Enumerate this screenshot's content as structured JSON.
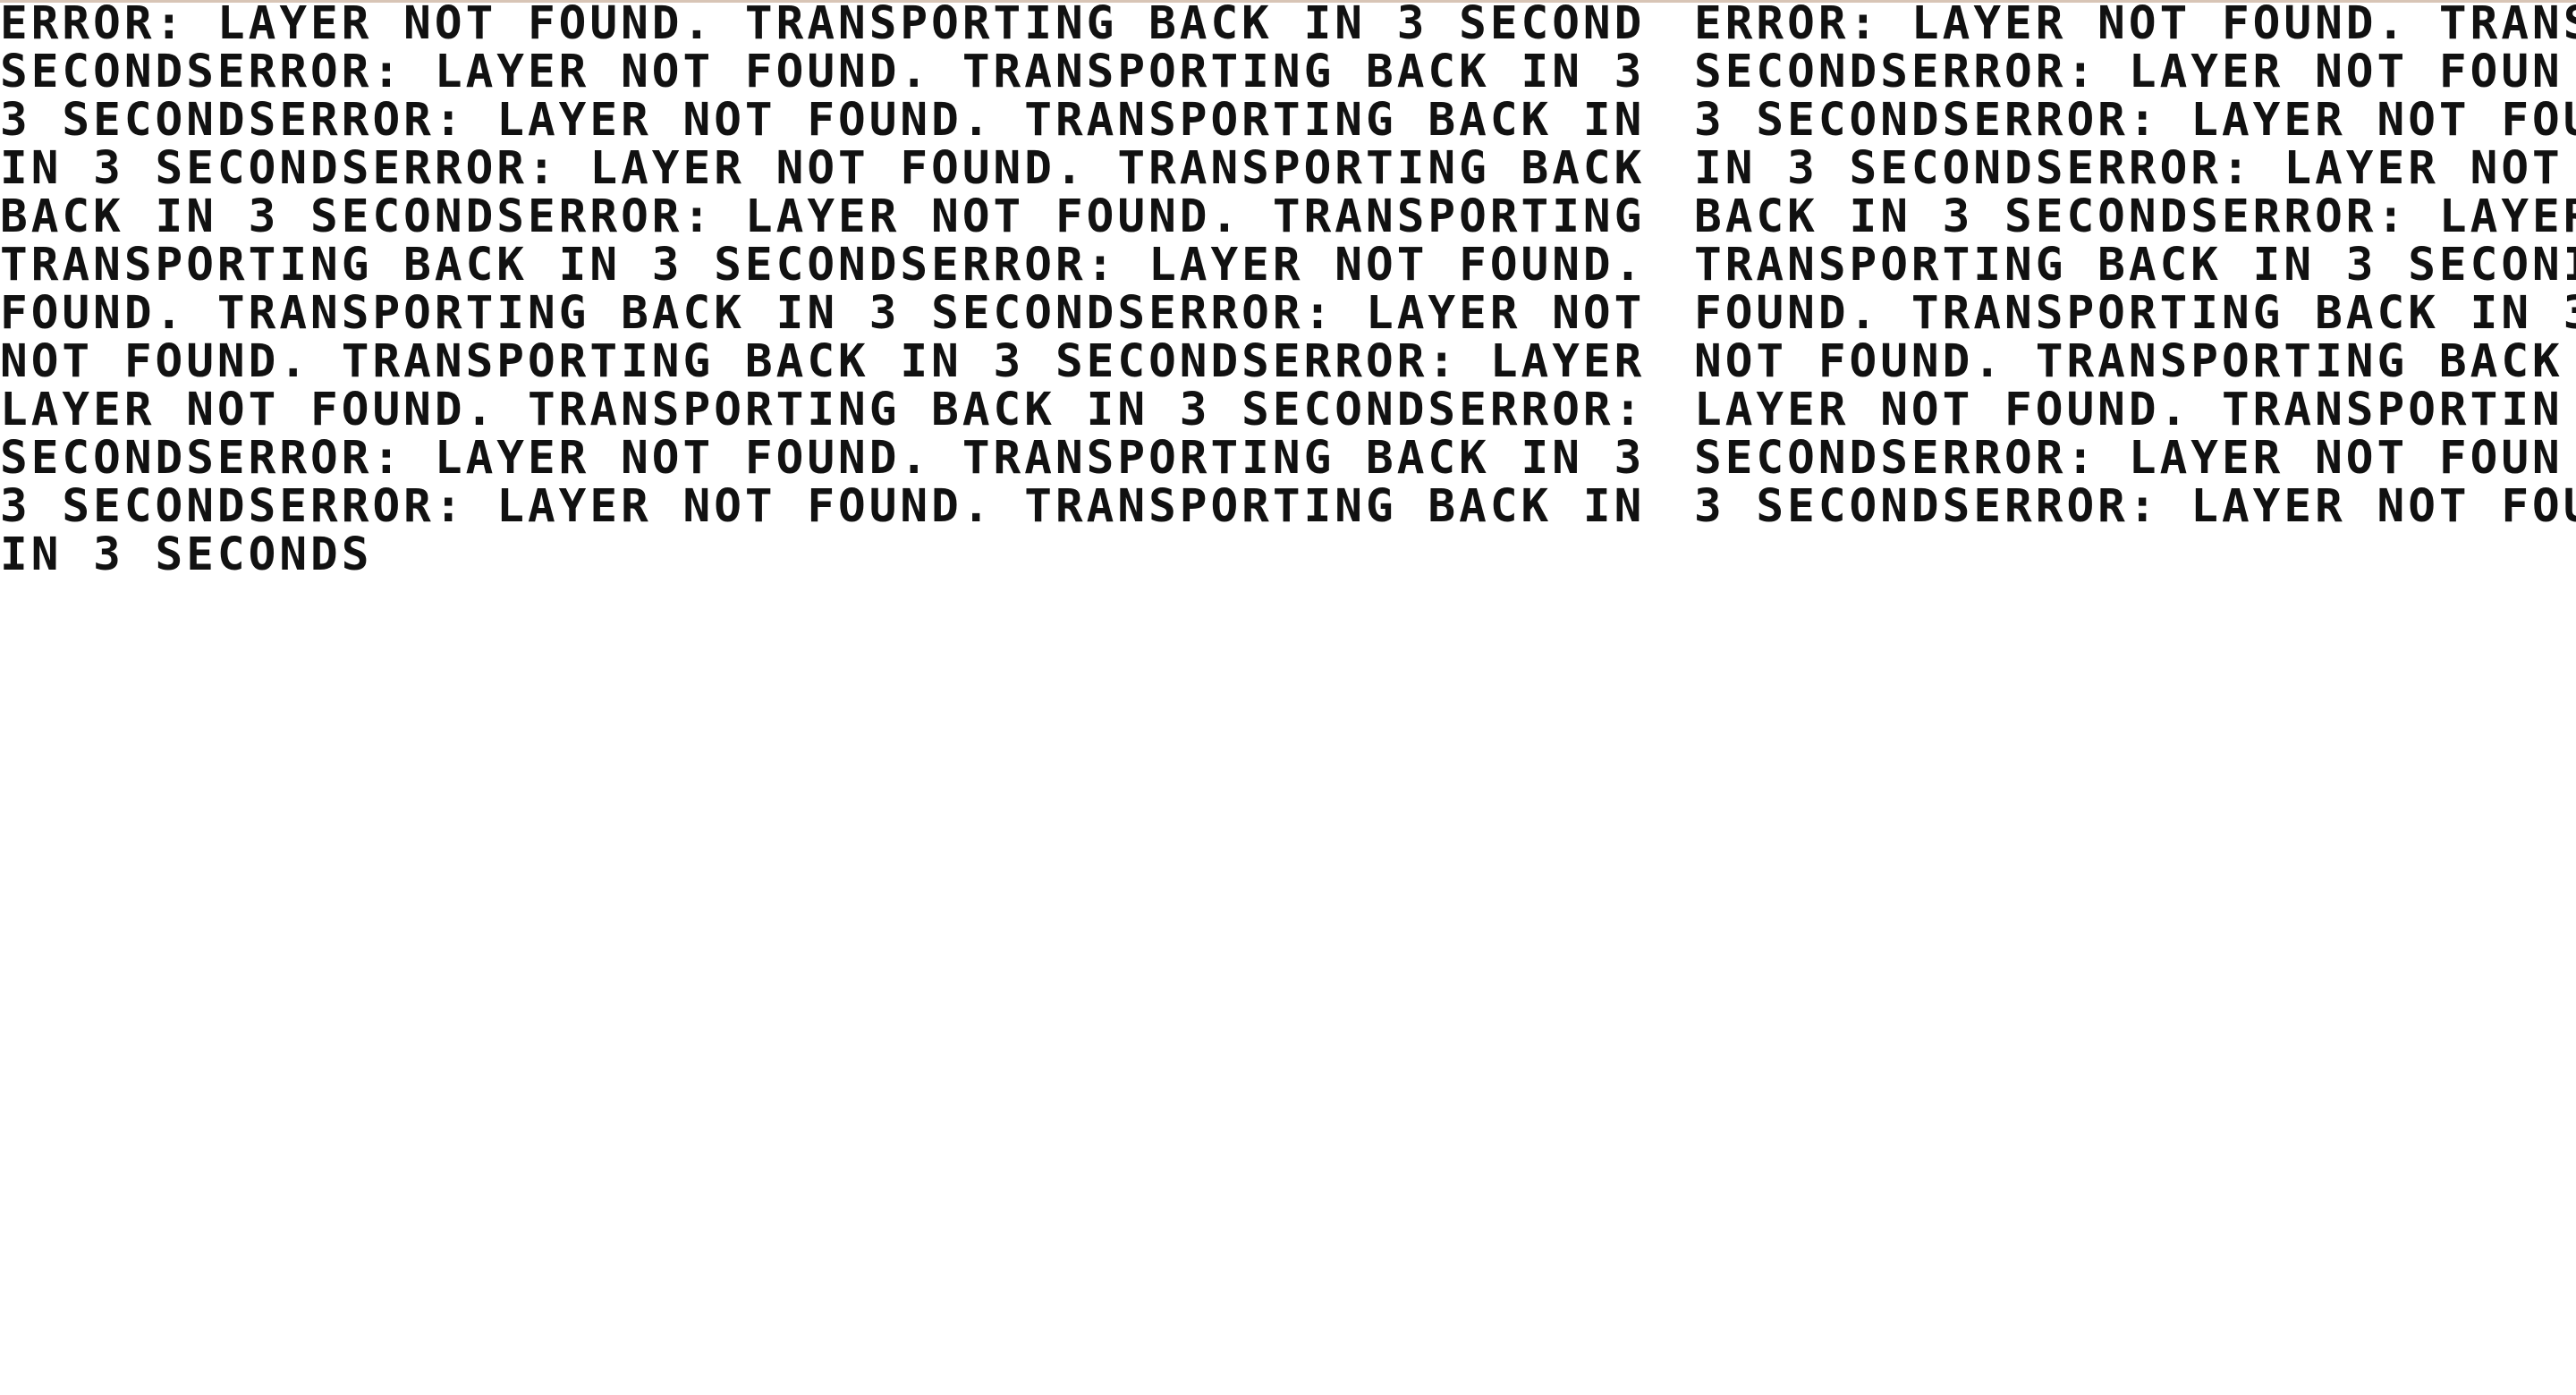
{
  "message": "ERROR: LAYER NOT FOUND. TRANSPORTING BACK IN 3 SECONDS",
  "left_column": [
    "ERROR: LAYER NOT FOUND. TRANSPORTING BACK IN 3 SECOND",
    "SECONDSERROR: LAYER NOT FOUND. TRANSPORTING BACK IN 3",
    "3 SECONDSERROR: LAYER NOT FOUND. TRANSPORTING BACK IN",
    "IN 3 SECONDSERROR: LAYER NOT FOUND. TRANSPORTING BACK",
    "BACK IN 3 SECONDSERROR: LAYER NOT FOUND. TRANSPORTING",
    "TRANSPORTING BACK IN 3 SECONDSERROR: LAYER NOT FOUND.",
    "FOUND. TRANSPORTING BACK IN 3 SECONDSERROR: LAYER NOT",
    "NOT FOUND. TRANSPORTING BACK IN 3 SECONDSERROR: LAYER",
    "LAYER NOT FOUND. TRANSPORTING BACK IN 3 SECONDSERROR:",
    "SECONDSERROR: LAYER NOT FOUND. TRANSPORTING BACK IN 3",
    "3 SECONDSERROR: LAYER NOT FOUND. TRANSPORTING BACK IN",
    "IN 3 SECONDS"
  ],
  "right_column": [
    "ERROR: LAYER NOT FOUND. TRANS",
    "SECONDSERROR: LAYER NOT FOUN",
    "3 SECONDSERROR: LAYER NOT FOU",
    "IN 3 SECONDSERROR: LAYER NOT",
    "BACK IN 3 SECONDSERROR: LAYER",
    "TRANSPORTING BACK IN 3 SECONI",
    "FOUND. TRANSPORTING BACK IN 3",
    "NOT FOUND. TRANSPORTING BACK",
    "LAYER NOT FOUND. TRANSPORTIN",
    "SECONDSERROR: LAYER NOT FOUN",
    "3 SECONDSERROR: LAYER NOT FOU"
  ]
}
